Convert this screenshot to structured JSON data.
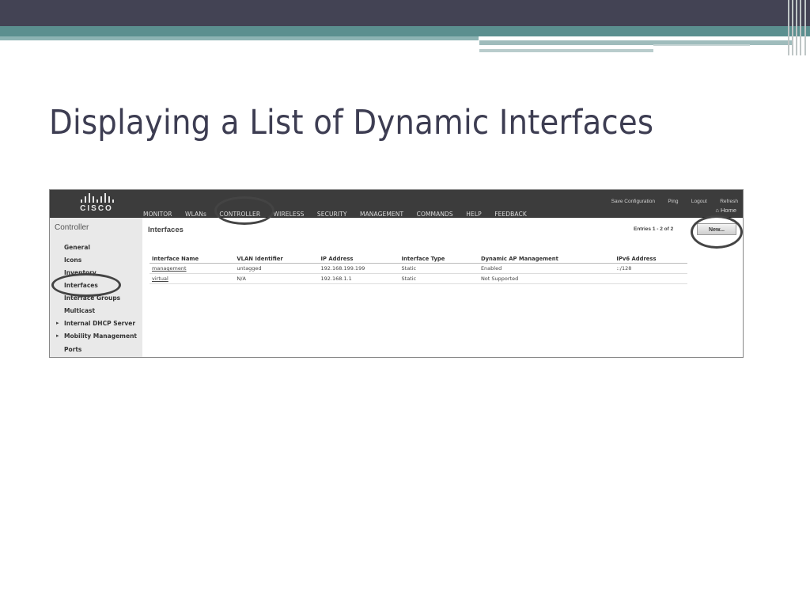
{
  "slide": {
    "title": "Displaying a List of Dynamic Interfaces"
  },
  "wlc": {
    "logo_text": "CISCO",
    "menu": [
      "MONITOR",
      "WLANs",
      "CONTROLLER",
      "WIRELESS",
      "SECURITY",
      "MANAGEMENT",
      "COMMANDS",
      "HELP",
      "FEEDBACK"
    ],
    "top_links": [
      "Save Configuration",
      "Ping",
      "Logout",
      "Refresh"
    ],
    "home_label": "Home",
    "sidebar": {
      "title": "Controller",
      "items": [
        "General",
        "Icons",
        "Inventory",
        "Interfaces",
        "Interface Groups",
        "Multicast",
        "Internal DHCP Server",
        "Mobility Management",
        "Ports"
      ]
    },
    "page_title": "Interfaces",
    "entries_text": "Entries 1 - 2 of 2",
    "new_button": "New...",
    "table": {
      "headers": [
        "Interface Name",
        "VLAN Identifier",
        "IP Address",
        "Interface Type",
        "Dynamic AP Management",
        "IPv6 Address"
      ],
      "rows": [
        [
          "management",
          "untagged",
          "192.168.199.199",
          "Static",
          "Enabled",
          "::/128"
        ],
        [
          "virtual",
          "N/A",
          "192.168.1.1",
          "Static",
          "Not Supported",
          ""
        ]
      ]
    }
  }
}
